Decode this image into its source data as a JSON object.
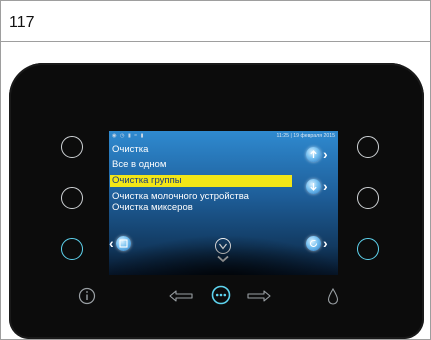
{
  "figure_label": "117",
  "status_bar": {
    "datetime": "11:25 | 19 февраля 2015",
    "icons": [
      "user-icon",
      "clock-icon",
      "thermometer-icon",
      "wifi-icon",
      "battery-icon"
    ]
  },
  "menu": {
    "items": [
      {
        "label": "Очистка",
        "selected": false
      },
      {
        "label": "Все в одном",
        "selected": false
      },
      {
        "label": "Очистка группы",
        "selected": true
      },
      {
        "label": "Очистка молочного устройства",
        "selected": false
      },
      {
        "label": "Очистка миксеров",
        "selected": false
      }
    ]
  },
  "screen_icons": [
    "scroll-up-icon",
    "scroll-down-icon",
    "back-icon",
    "confirm-icon",
    "rotate-icon"
  ],
  "bottom_bar_icons": [
    "info-icon",
    "arrow-left-icon",
    "menu-dots-icon",
    "arrow-right-icon",
    "water-drop-icon"
  ],
  "colors": {
    "accent_cyan": "#5ed3ee",
    "selection_yellow": "#f2e617",
    "selection_text": "#1d3e7a",
    "panel_black": "#0c0c0c",
    "screen_blue": "#2f8ad0"
  }
}
